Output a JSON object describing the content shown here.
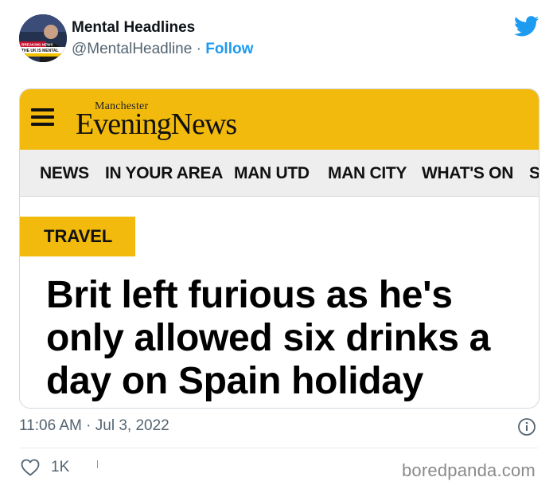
{
  "author": {
    "name": "Mental Headlines",
    "handle": "@MentalHeadline",
    "separator": "·",
    "follow_label": "Follow"
  },
  "icons": {
    "brand": "twitter-bird-icon",
    "menu": "hamburger-menu-icon",
    "info": "info-icon",
    "like": "heart-icon"
  },
  "avatar": {
    "banner_text": "BREAKING NEWS",
    "caption": "THE UK IS MENTAL"
  },
  "article": {
    "masthead_small": "Manchester",
    "masthead_big": "EveningNews",
    "nav": [
      "NEWS",
      "IN YOUR AREA",
      "MAN UTD",
      "MAN CITY",
      "WHAT'S ON",
      "S"
    ],
    "tag": "TRAVEL",
    "headline": "Brit left furious as he's only allowed six drinks a day on Spain holiday"
  },
  "tweet": {
    "timestamp": "11:06 AM · Jul 3, 2022",
    "likes": "1K"
  },
  "watermark": "boredpanda.com",
  "colors": {
    "men_yellow": "#f1ba0d",
    "twitter_blue": "#1d9bf0",
    "muted_text": "#536471"
  }
}
